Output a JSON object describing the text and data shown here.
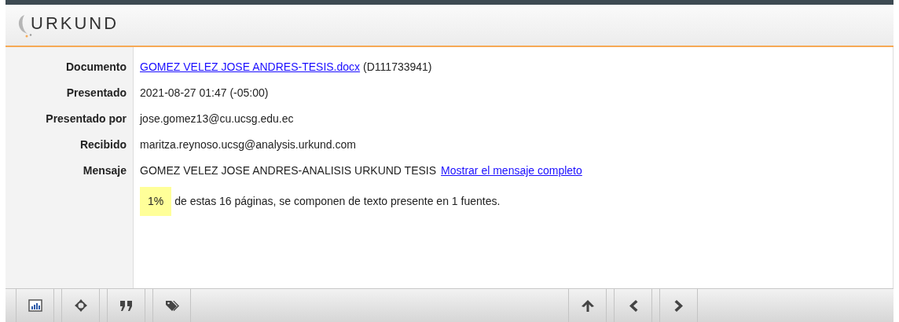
{
  "logo": {
    "text": "URKUND"
  },
  "fields": [
    {
      "label": "Documento",
      "link": "GOMEZ VELEZ JOSE ANDRES-TESIS.docx",
      "value": "(D111733941)",
      "kind": "link_first"
    },
    {
      "label": "Presentado",
      "value": "2021-08-27 01:47 (-05:00)",
      "kind": "plain"
    },
    {
      "label": "Presentado por",
      "value": "jose.gomez13@cu.ucsg.edu.ec",
      "kind": "plain"
    },
    {
      "label": "Recibido",
      "value": "maritza.reynoso.ucsg@analysis.urkund.com",
      "kind": "plain"
    },
    {
      "label": "Mensaje",
      "value": "GOMEZ VELEZ JOSE ANDRES-ANALISIS URKUND TESIS",
      "link": "Mostrar el mensaje completo",
      "kind": "link_last"
    }
  ],
  "summary": {
    "percent": "1%",
    "text": "de estas 16 páginas, se componen de texto presente en 1 fuentes."
  },
  "toolbar": {
    "left": [
      {
        "kind": "chart"
      },
      {
        "kind": "crosshair"
      },
      {
        "kind": "quote"
      },
      {
        "kind": "tags"
      }
    ],
    "right": [
      {
        "kind": "up"
      },
      {
        "kind": "prev"
      },
      {
        "kind": "next"
      }
    ]
  }
}
